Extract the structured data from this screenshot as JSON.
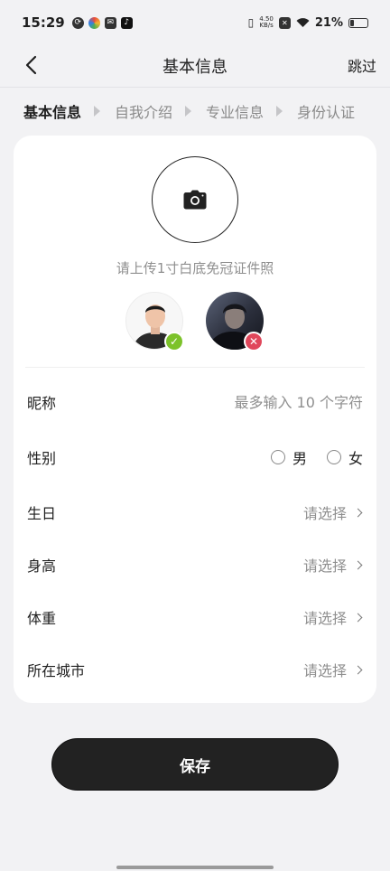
{
  "status_bar": {
    "time": "15:29",
    "net_speed_value": "4.50",
    "net_speed_unit": "KB/s",
    "battery": "21%",
    "battery_level": 0.21,
    "icons": [
      "sync-icon",
      "colorful-app-icon",
      "mail-icon",
      "tiktok-icon",
      "vibrate-icon",
      "sim-off-icon",
      "wifi-icon",
      "battery-icon"
    ]
  },
  "nav": {
    "back_icon": "chevron-left-icon",
    "title": "基本信息",
    "skip_label": "跳过"
  },
  "steps": [
    {
      "label": "基本信息",
      "active": true
    },
    {
      "label": "自我介绍",
      "active": false
    },
    {
      "label": "专业信息",
      "active": false
    },
    {
      "label": "身份认证",
      "active": false
    }
  ],
  "upload": {
    "icon": "camera-icon",
    "hint": "请上传1寸白底免冠证件照"
  },
  "examples": {
    "good_badge": "✓",
    "bad_badge": "✕",
    "good_color": "#7cc22a",
    "bad_color": "#e0475b"
  },
  "form": {
    "nickname": {
      "label": "昵称",
      "value": "",
      "placeholder": "最多输入 10 个字符"
    },
    "gender": {
      "label": "性别",
      "options": [
        "男",
        "女"
      ]
    },
    "birthday": {
      "label": "生日",
      "value": "请选择"
    },
    "height": {
      "label": "身高",
      "value": "请选择"
    },
    "weight": {
      "label": "体重",
      "value": "请选择"
    },
    "city": {
      "label": "所在城市",
      "value": "请选择"
    }
  },
  "save_label": "保存",
  "colors": {
    "background": "#f2f2f4",
    "card": "#ffffff",
    "primary_button": "#222222",
    "muted_text": "#8f8f8f"
  }
}
